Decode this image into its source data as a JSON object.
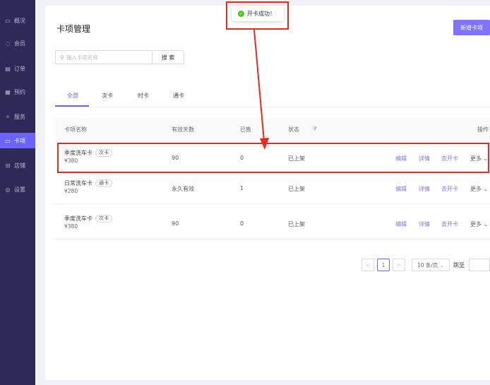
{
  "sidebar": {
    "items": [
      {
        "label": "概况",
        "icon": "overview-icon",
        "glyph": "▭"
      },
      {
        "label": "会员",
        "icon": "member-icon",
        "glyph": "◌"
      },
      {
        "label": "订单",
        "icon": "order-icon",
        "glyph": "▤"
      },
      {
        "label": "预约",
        "icon": "booking-icon",
        "glyph": "▦"
      },
      {
        "label": "服务",
        "icon": "service-icon",
        "glyph": "✧"
      },
      {
        "label": "卡项",
        "icon": "card-icon",
        "glyph": "▭"
      },
      {
        "label": "店铺",
        "icon": "store-icon",
        "glyph": "⊟"
      },
      {
        "label": "设置",
        "icon": "settings-icon",
        "glyph": "◎"
      }
    ],
    "active_index": 5
  },
  "page": {
    "title": "卡项管理",
    "new_button": "新增卡项"
  },
  "search": {
    "placeholder": "输入卡项名称",
    "button": "搜 索"
  },
  "tabs": [
    "全部",
    "次卡",
    "时卡",
    "通卡"
  ],
  "table": {
    "headers": [
      "卡项名称",
      "有效天数",
      "已售",
      "状态",
      "操作"
    ],
    "rows": [
      {
        "name": "季度洗车卡",
        "tag": "次卡",
        "price": "¥380",
        "days": "90",
        "sold": "0",
        "status": "已上架"
      },
      {
        "name": "日常洗车卡",
        "tag": "通卡",
        "price": "¥280",
        "days": "永久有效",
        "sold": "1",
        "status": "已上架"
      },
      {
        "name": "季度洗车卡",
        "tag": "次卡",
        "price": "¥380",
        "days": "90",
        "sold": "0",
        "status": "已上架"
      }
    ],
    "actions": {
      "edit": "编辑",
      "detail": "详情",
      "open": "去开卡",
      "more": "更多"
    }
  },
  "pagination": {
    "prev": "<",
    "page": "1",
    "next": ">",
    "page_size": "10 条/页",
    "jump_label": "跳至"
  },
  "toast": {
    "message": "开卡成功！"
  },
  "colors": {
    "sidebar_bg": "#2d2a57",
    "accent": "#6c63ff",
    "annotation": "#e8291c",
    "success": "#52c41a"
  }
}
